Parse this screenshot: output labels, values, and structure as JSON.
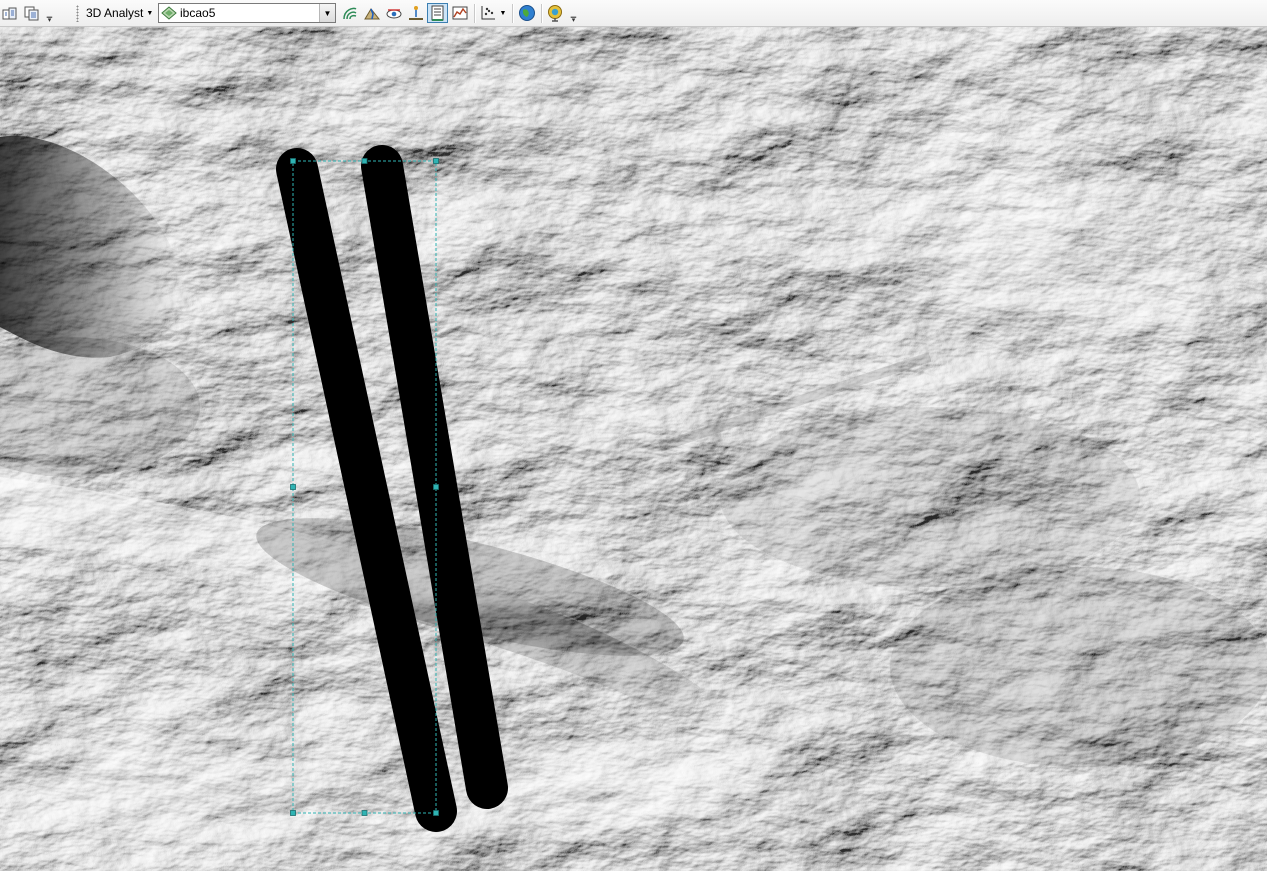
{
  "toolbar": {
    "extension_menu_label": "3D Analyst",
    "layer_select_value": "ibcao5",
    "icons": [
      "layer-properties-icon",
      "copy-layer-icon",
      "toolbar-options-icon",
      "contour-icon",
      "steepest-path-icon",
      "line-of-sight-icon",
      "interpolate-line-icon",
      "interpolate-polygon-icon",
      "profile-graph-icon",
      "scatter-plot-icon",
      "arcglobe-icon",
      "arcscene-icon"
    ],
    "pressed_tool": "interpolate-polygon-icon"
  },
  "map": {
    "layer": "ibcao5",
    "selection_color": "#2fb3b3",
    "graphic_color": "#000000"
  }
}
